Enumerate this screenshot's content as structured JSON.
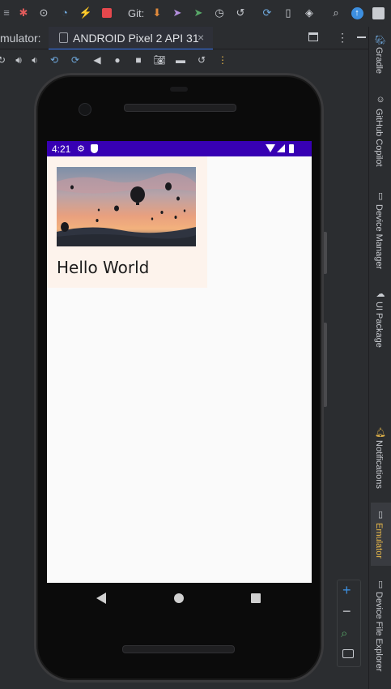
{
  "toolbar": {
    "git_label": "Git:",
    "icons": [
      "list-icon",
      "bug-icon",
      "attach-debugger-icon",
      "profiler-icon",
      "apply-changes-icon",
      "stop-icon",
      "update-project-icon",
      "commit-icon",
      "push-icon",
      "history-icon",
      "rollback-icon",
      "sync-gradle-icon",
      "device-mirror-icon",
      "sdk-manager-icon",
      "search-icon",
      "updates-icon",
      "account-icon"
    ]
  },
  "tabbar": {
    "panel_label": "mulator:",
    "tab_title": "ANDROID Pixel 2 API 31",
    "tab_close": "×"
  },
  "right_strip": {
    "items": [
      "Gradle",
      "GitHub Copilot",
      "Device Manager",
      "UI Package",
      "Notifications",
      "Emulator",
      "Device File Explorer"
    ]
  },
  "device": {
    "status_time": "4:21",
    "status_bar_color": "#3700b3",
    "card_text": "Hello World",
    "image_description_name": "hot-air-balloons-image"
  },
  "zoom": {
    "zoom_in": "+",
    "zoom_out": "−"
  },
  "colors": {
    "accent_blue": "#3574f0",
    "status_purple": "#3700b3",
    "emulator_active": "#e8b84a"
  }
}
